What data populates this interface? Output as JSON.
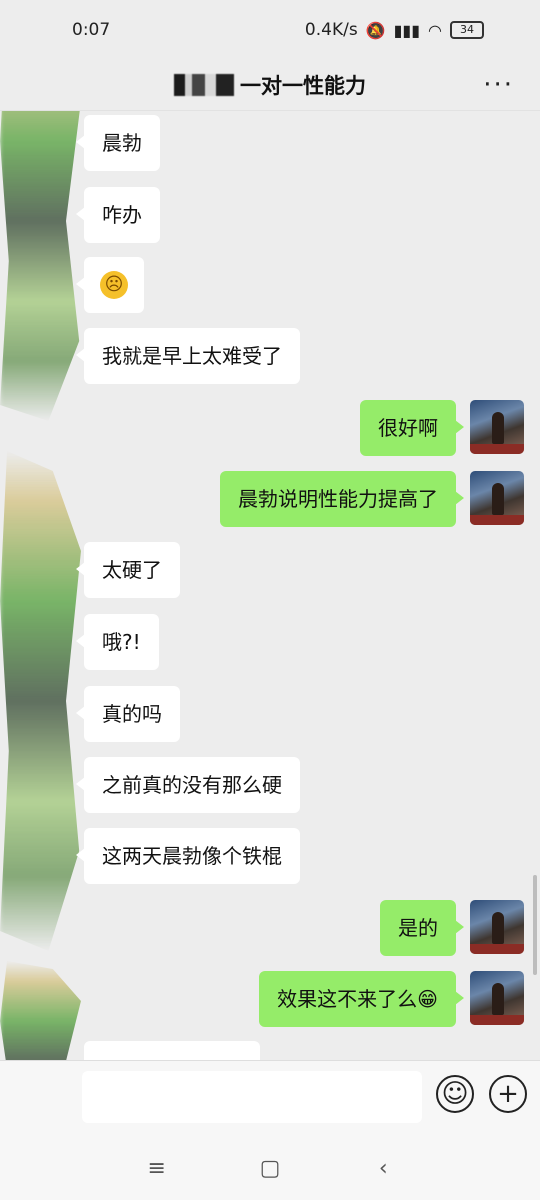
{
  "status_bar": {
    "time": "0:07",
    "speed": "0.4K/s",
    "icons": [
      "mute-bell-icon",
      "hd-signal-icon",
      "wifi-icon"
    ],
    "battery": "34"
  },
  "header": {
    "title": "一对一性能力",
    "more_icon": "···"
  },
  "messages": [
    {
      "side": "left",
      "text": "晨勃"
    },
    {
      "side": "left",
      "text": "咋办"
    },
    {
      "side": "left",
      "text": "😭",
      "emoji": true
    },
    {
      "side": "left",
      "text": "我就是早上太难受了"
    },
    {
      "side": "right",
      "text": "很好啊"
    },
    {
      "side": "right",
      "text": "晨勃说明性能力提高了"
    },
    {
      "side": "left",
      "text": "太硬了"
    },
    {
      "side": "left",
      "text": "哦?!"
    },
    {
      "side": "left",
      "text": "真的吗"
    },
    {
      "side": "left",
      "text": "之前真的没有那么硬"
    },
    {
      "side": "left",
      "text": "这两天晨勃像个铁棍"
    },
    {
      "side": "right",
      "text": "是的"
    },
    {
      "side": "right",
      "text": "效果这不来了么😁"
    }
  ],
  "input_bar": {
    "emoji_icon": "☺",
    "plus_icon": "+"
  },
  "nav_bar": {
    "menu_icon": "≡",
    "home_icon": "▢",
    "back_icon": "‹"
  }
}
